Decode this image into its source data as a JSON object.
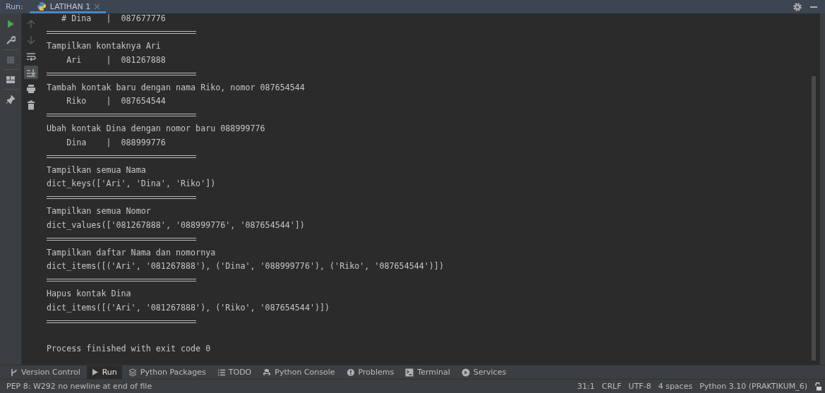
{
  "run_header": {
    "label": "Run:",
    "tab": {
      "title": "LATIHAN 1",
      "selected": true
    }
  },
  "left_toolbar": [
    {
      "kind": "run",
      "disabled": false
    },
    {
      "kind": "wrench",
      "disabled": false
    },
    {
      "kind": "stop",
      "disabled": true
    },
    {
      "kind": "layout",
      "disabled": false
    },
    {
      "kind": "pin",
      "disabled": false
    }
  ],
  "output_toolbar": [
    {
      "kind": "up",
      "disabled": true,
      "selected": false
    },
    {
      "kind": "down",
      "disabled": true,
      "selected": false
    },
    {
      "kind": "wrap",
      "disabled": false,
      "selected": false
    },
    {
      "kind": "scroll-end",
      "disabled": false,
      "selected": true
    },
    {
      "kind": "print",
      "disabled": false,
      "selected": false
    },
    {
      "kind": "trash",
      "disabled": false,
      "selected": false
    }
  ],
  "console_lines": [
    {
      "kind": "text",
      "text": "   # Dina   |  087677776"
    },
    {
      "kind": "rule"
    },
    {
      "kind": "text",
      "text": "Tampilkan kontaknya Ari"
    },
    {
      "kind": "text",
      "text": "    Ari     |  081267888"
    },
    {
      "kind": "rule"
    },
    {
      "kind": "text",
      "text": "Tambah kontak baru dengan nama Riko, nomor 087654544"
    },
    {
      "kind": "text",
      "text": "    Riko    |  087654544"
    },
    {
      "kind": "rule"
    },
    {
      "kind": "text",
      "text": "Ubah kontak Dina dengan nomor baru 088999776"
    },
    {
      "kind": "text",
      "text": "    Dina    |  088999776"
    },
    {
      "kind": "rule"
    },
    {
      "kind": "text",
      "text": "Tampilkan semua Nama"
    },
    {
      "kind": "text",
      "text": "dict_keys(['Ari', 'Dina', 'Riko'])"
    },
    {
      "kind": "rule"
    },
    {
      "kind": "text",
      "text": "Tampilkan semua Nomor"
    },
    {
      "kind": "text",
      "text": "dict_values(['081267888', '088999776', '087654544'])"
    },
    {
      "kind": "rule"
    },
    {
      "kind": "text",
      "text": "Tampilkan daftar Nama dan nomornya"
    },
    {
      "kind": "text",
      "text": "dict_items([('Ari', '081267888'), ('Dina', '088999776'), ('Riko', '087654544')])"
    },
    {
      "kind": "rule"
    },
    {
      "kind": "text",
      "text": "Hapus kontak Dina"
    },
    {
      "kind": "text",
      "text": "dict_items([('Ari', '081267888'), ('Riko', '087654544')])"
    },
    {
      "kind": "rule"
    },
    {
      "kind": "blank"
    },
    {
      "kind": "text",
      "text": "Process finished with exit code 0"
    }
  ],
  "tool_tabs": [
    {
      "kind": "vcs",
      "label": "Version Control",
      "selected": false
    },
    {
      "kind": "run",
      "label": "Run",
      "selected": true
    },
    {
      "kind": "packages",
      "label": "Python Packages",
      "selected": false
    },
    {
      "kind": "todo",
      "label": "TODO",
      "selected": false
    },
    {
      "kind": "console",
      "label": "Python Console",
      "selected": false
    },
    {
      "kind": "problems",
      "label": "Problems",
      "selected": false
    },
    {
      "kind": "terminal",
      "label": "Terminal",
      "selected": false
    },
    {
      "kind": "services",
      "label": "Services",
      "selected": false
    }
  ],
  "status_bar": {
    "message": "PEP 8: W292 no newline at end of file",
    "items": [
      "31:1",
      "CRLF",
      "UTF-8",
      "4 spaces",
      "Python 3.10 (PRAKTIKUM_6)"
    ]
  }
}
